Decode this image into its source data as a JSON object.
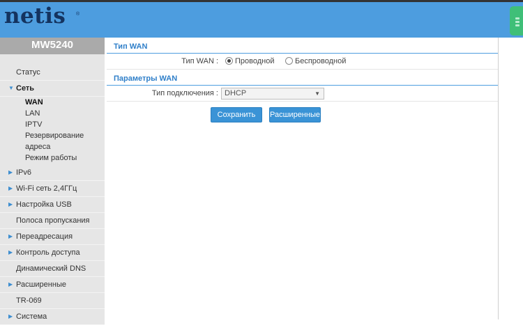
{
  "header": {
    "logo": "netis",
    "logo_mark": "®"
  },
  "sidebar": {
    "model": "MW5240",
    "items": [
      {
        "label": "Статус",
        "arrow": false
      },
      {
        "label": "Сеть",
        "arrow": true,
        "open": true
      },
      {
        "label": "IPv6",
        "arrow": true
      },
      {
        "label": "Wi-Fi сеть 2,4ГГц",
        "arrow": true
      },
      {
        "label": "Настройка USB",
        "arrow": true
      },
      {
        "label": "Полоса пропускания",
        "arrow": false
      },
      {
        "label": "Переадресация",
        "arrow": true
      },
      {
        "label": "Контроль доступа",
        "arrow": true
      },
      {
        "label": "Динамический DNS",
        "arrow": false
      },
      {
        "label": "Расширенные",
        "arrow": true
      },
      {
        "label": "TR-069",
        "arrow": false
      },
      {
        "label": "Система",
        "arrow": true
      }
    ],
    "subitems": [
      "WAN",
      "LAN",
      "IPTV",
      "Резервирование",
      "адреса",
      "Режим работы"
    ],
    "active_subitem": "WAN"
  },
  "wan_type": {
    "title": "Тип WAN",
    "label": "Тип WAN :",
    "options": [
      "Проводной",
      "Беспроводной"
    ],
    "selected": "Проводной"
  },
  "wan_params": {
    "title": "Параметры WAN",
    "conn_label": "Тип подключения :",
    "conn_value": "DHCP"
  },
  "buttons": {
    "save": "Сохранить",
    "advanced": "Расширенные"
  },
  "icons": {
    "arrow": "triangle-right-icon",
    "arrow_open": "triangle-down-icon",
    "caret": "chevron-down-icon"
  },
  "colors": {
    "header": "#4d9ddf",
    "accent": "#2f7fc9",
    "button": "#3a93d6",
    "sidebar": "#e6e6e6"
  }
}
